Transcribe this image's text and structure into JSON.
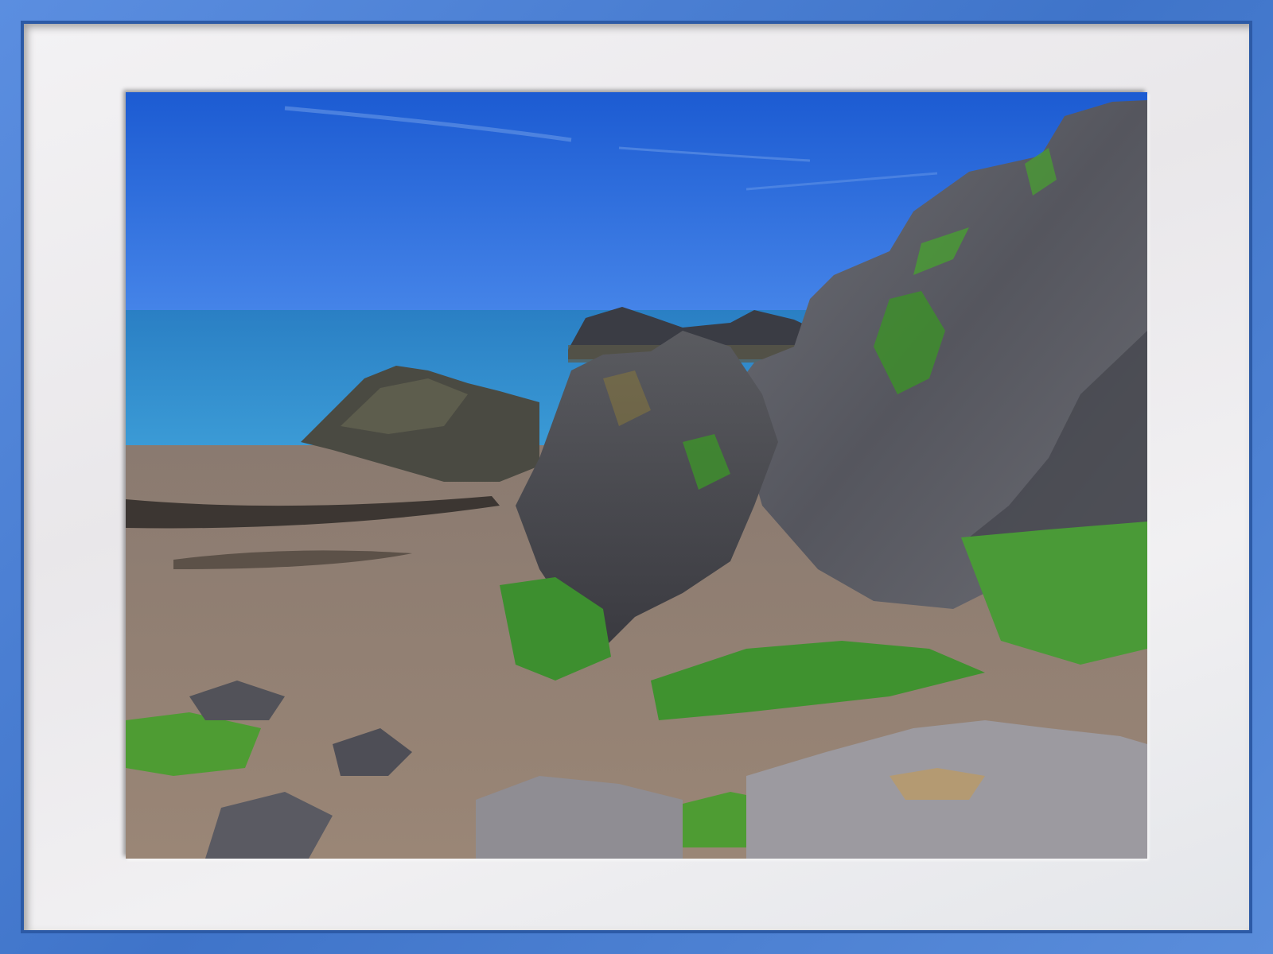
{
  "photo": {
    "subject": "rocky-beach-coastline",
    "colors": {
      "frame": "#4a7fd0",
      "mat": "#efeef0",
      "sky_top": "#1f5fd6",
      "sky_bottom": "#3f7fe6",
      "sea": "#2a86c8",
      "sand": "#8c7b6d",
      "rock": "#4a4b52",
      "grass": "#3d8f2f"
    }
  }
}
